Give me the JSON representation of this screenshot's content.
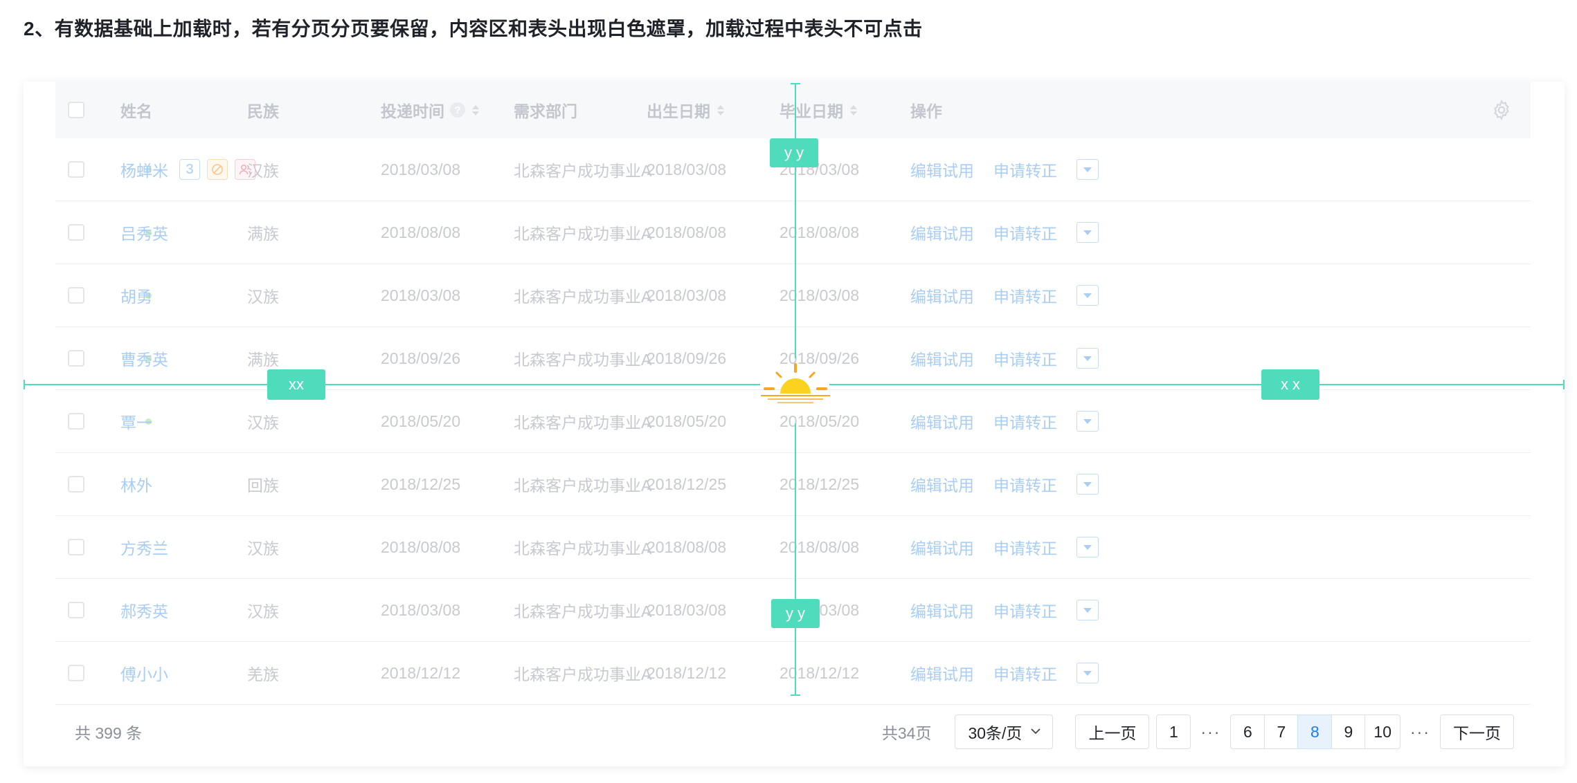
{
  "heading": "2、有数据基础上加载时，若有分页分页要保留，内容区和表头出现白色遮罩，加载过程中表头不可点击",
  "table": {
    "columns": [
      "姓名",
      "民族",
      "投递时间",
      "需求部门",
      "出生日期",
      "毕业日期",
      "操作"
    ],
    "help_mark": "?",
    "rows": [
      {
        "name": "杨蝉米",
        "ethnicity": "汉族",
        "submitted": "2018/03/08",
        "dept": "北森客户成功事业A",
        "birth": "2018/03/08",
        "grad": "2018/03/08",
        "tag_count": "3"
      },
      {
        "name": "吕秀英",
        "ethnicity": "满族",
        "submitted": "2018/08/08",
        "dept": "北森客户成功事业A",
        "birth": "2018/08/08",
        "grad": "2018/08/08"
      },
      {
        "name": "胡勇",
        "ethnicity": "汉族",
        "submitted": "2018/03/08",
        "dept": "北森客户成功事业A",
        "birth": "2018/03/08",
        "grad": "2018/03/08"
      },
      {
        "name": "曹秀英",
        "ethnicity": "满族",
        "submitted": "2018/09/26",
        "dept": "北森客户成功事业A",
        "birth": "2018/09/26",
        "grad": "2018/09/26"
      },
      {
        "name": "覃一",
        "ethnicity": "汉族",
        "submitted": "2018/05/20",
        "dept": "北森客户成功事业A",
        "birth": "2018/05/20",
        "grad": "2018/05/20"
      },
      {
        "name": "林外",
        "ethnicity": "回族",
        "submitted": "2018/12/25",
        "dept": "北森客户成功事业A",
        "birth": "2018/12/25",
        "grad": "2018/12/25"
      },
      {
        "name": "方秀兰",
        "ethnicity": "汉族",
        "submitted": "2018/08/08",
        "dept": "北森客户成功事业A",
        "birth": "2018/08/08",
        "grad": "2018/08/08"
      },
      {
        "name": "郝秀英",
        "ethnicity": "汉族",
        "submitted": "2018/03/08",
        "dept": "北森客户成功事业A",
        "birth": "2018/03/08",
        "grad": "2018/03/08"
      },
      {
        "name": "傅小小",
        "ethnicity": "羌族",
        "submitted": "2018/12/12",
        "dept": "北森客户成功事业A",
        "birth": "2018/12/12",
        "grad": "2018/12/12"
      }
    ],
    "actions": {
      "edit": "编辑试用",
      "apply": "申请转正"
    }
  },
  "footer": {
    "total": "共 399 条",
    "pages_total": "共34页",
    "page_size": "30条/页",
    "prev": "上一页",
    "next": "下一页",
    "first_page": "1",
    "ellipsis": "···",
    "pages": [
      "6",
      "7",
      "8",
      "9",
      "10"
    ],
    "active_page": "8"
  },
  "overlay": {
    "label_left": "xx",
    "label_right": "x x",
    "label_top": "y y",
    "label_bottom": "y y"
  },
  "colors": {
    "accent": "#4fdcbc",
    "link": "#a9cdf4",
    "active_page": "#1f7ce0",
    "spinner": "#fbd21f",
    "spinner_rays": "#f6a623"
  },
  "icons": [
    "settings-gear-icon",
    "help-icon",
    "sort-icon",
    "chevron-down-icon",
    "loading-sun-icon"
  ]
}
